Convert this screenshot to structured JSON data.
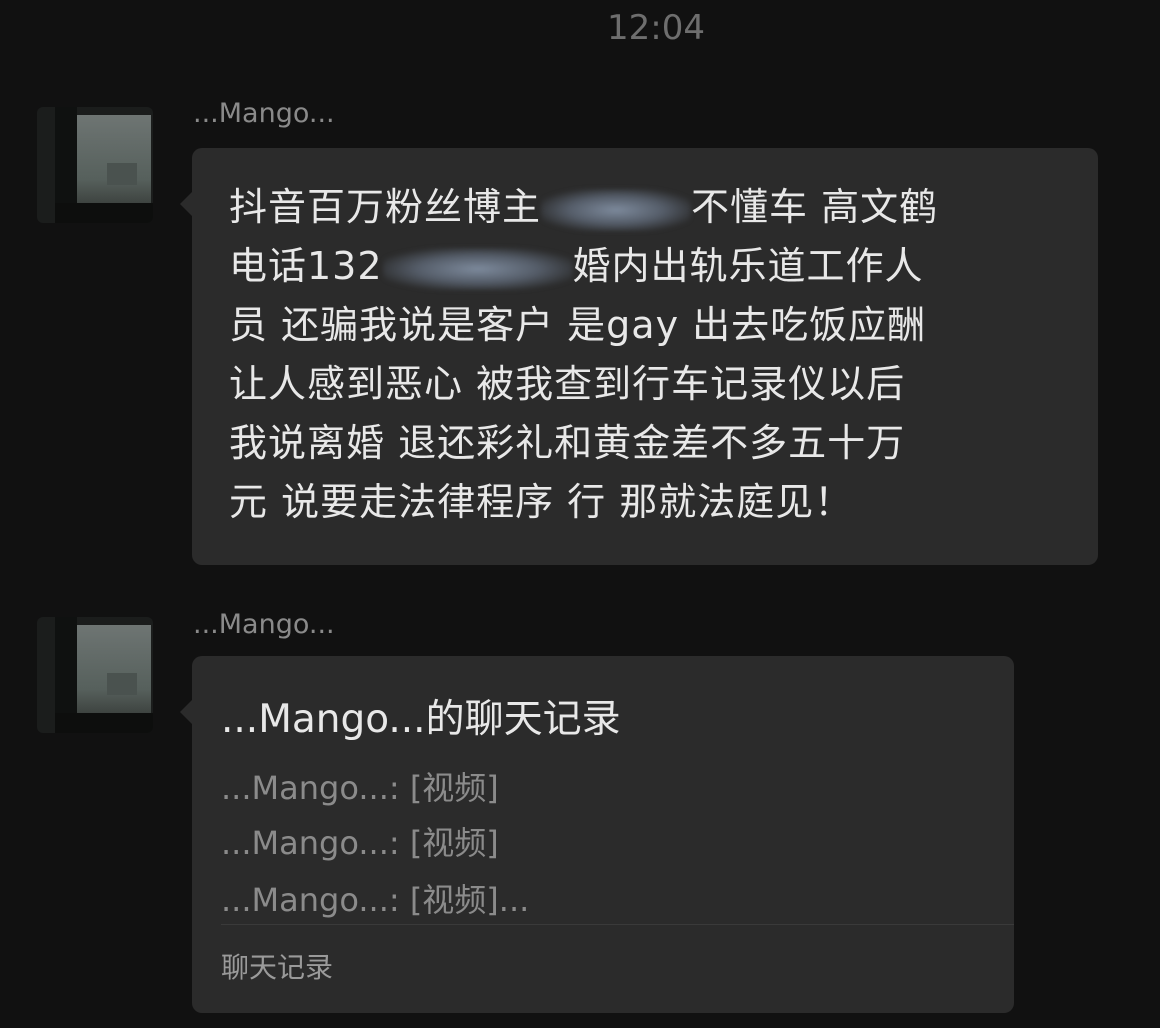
{
  "status": {
    "time": "12:04"
  },
  "messages": [
    {
      "sender": "...Mango...",
      "text_parts": {
        "p1": "抖音百万粉丝博主",
        "p2": "不懂车 高文鹤",
        "p3": "电话132",
        "p4": "婚内出轨乐道工作人",
        "p5": "员 还骗我说是客户 是gay 出去吃饭应酬",
        "p6": "让人感到恶心 被我查到行车记录仪以后",
        "p7": "我说离婚 退还彩礼和黄金差不多五十万",
        "p8": "元 说要走法律程序 行 那就法庭见！"
      }
    },
    {
      "sender": "...Mango...",
      "chat_record": {
        "title": "...Mango...的聊天记录",
        "lines": [
          "...Mango...: [视频]",
          "...Mango...: [视频]",
          "...Mango...: [视频]..."
        ],
        "footer": "聊天记录"
      }
    }
  ]
}
